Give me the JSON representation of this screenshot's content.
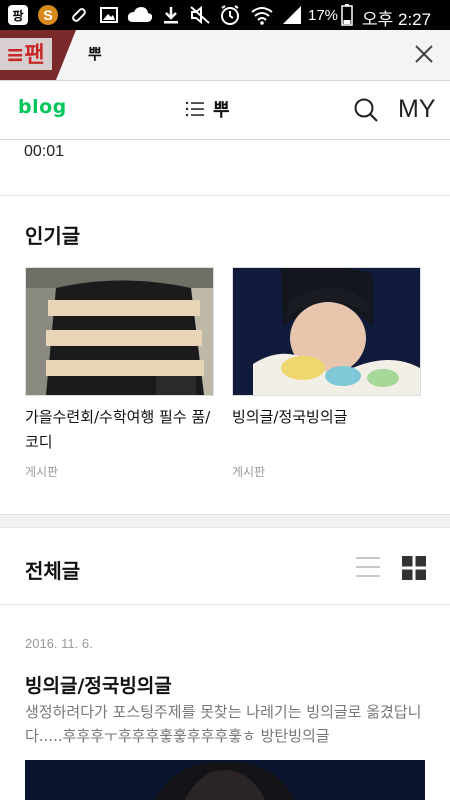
{
  "status_bar": {
    "battery": "17%",
    "clock": "오후 2:27",
    "icons": [
      "app-logo-icon",
      "s-app-icon",
      "pill-icon",
      "image-icon",
      "cloud-icon",
      "download-icon",
      "mute-icon",
      "alarm-icon",
      "wifi-icon",
      "signal-icon",
      "battery-icon"
    ]
  },
  "tab": {
    "title": "뿌",
    "close_icon": "close-icon"
  },
  "header": {
    "logo": "blog",
    "title": "뿌",
    "my": "MY",
    "icons": [
      "menu-icon",
      "search-icon"
    ]
  },
  "time": "00:01",
  "popular": {
    "title": "인기글",
    "cards": [
      {
        "title": "가을수련회/수학여행 필수 품/코디",
        "category": "게시판"
      },
      {
        "title": "빙의글/정국빙의글",
        "category": "게시판"
      }
    ]
  },
  "all_posts": {
    "title": "전체글",
    "view_icons": [
      "list-view-icon",
      "grid-view-icon"
    ],
    "post": {
      "date": "2016. 11. 6.",
      "title": "빙의글/정국빙의글",
      "excerpt": "생정하려다가 포스팅주제를 못찾는 나레기는 빙의글로 옮겼답니다.....후후후ㅜ후후후훟훟후후후훟ㅎ 방탄빙의글"
    }
  },
  "colors": {
    "brand": "#03c75a",
    "status_bg": "#000000",
    "muted": "#999999"
  }
}
